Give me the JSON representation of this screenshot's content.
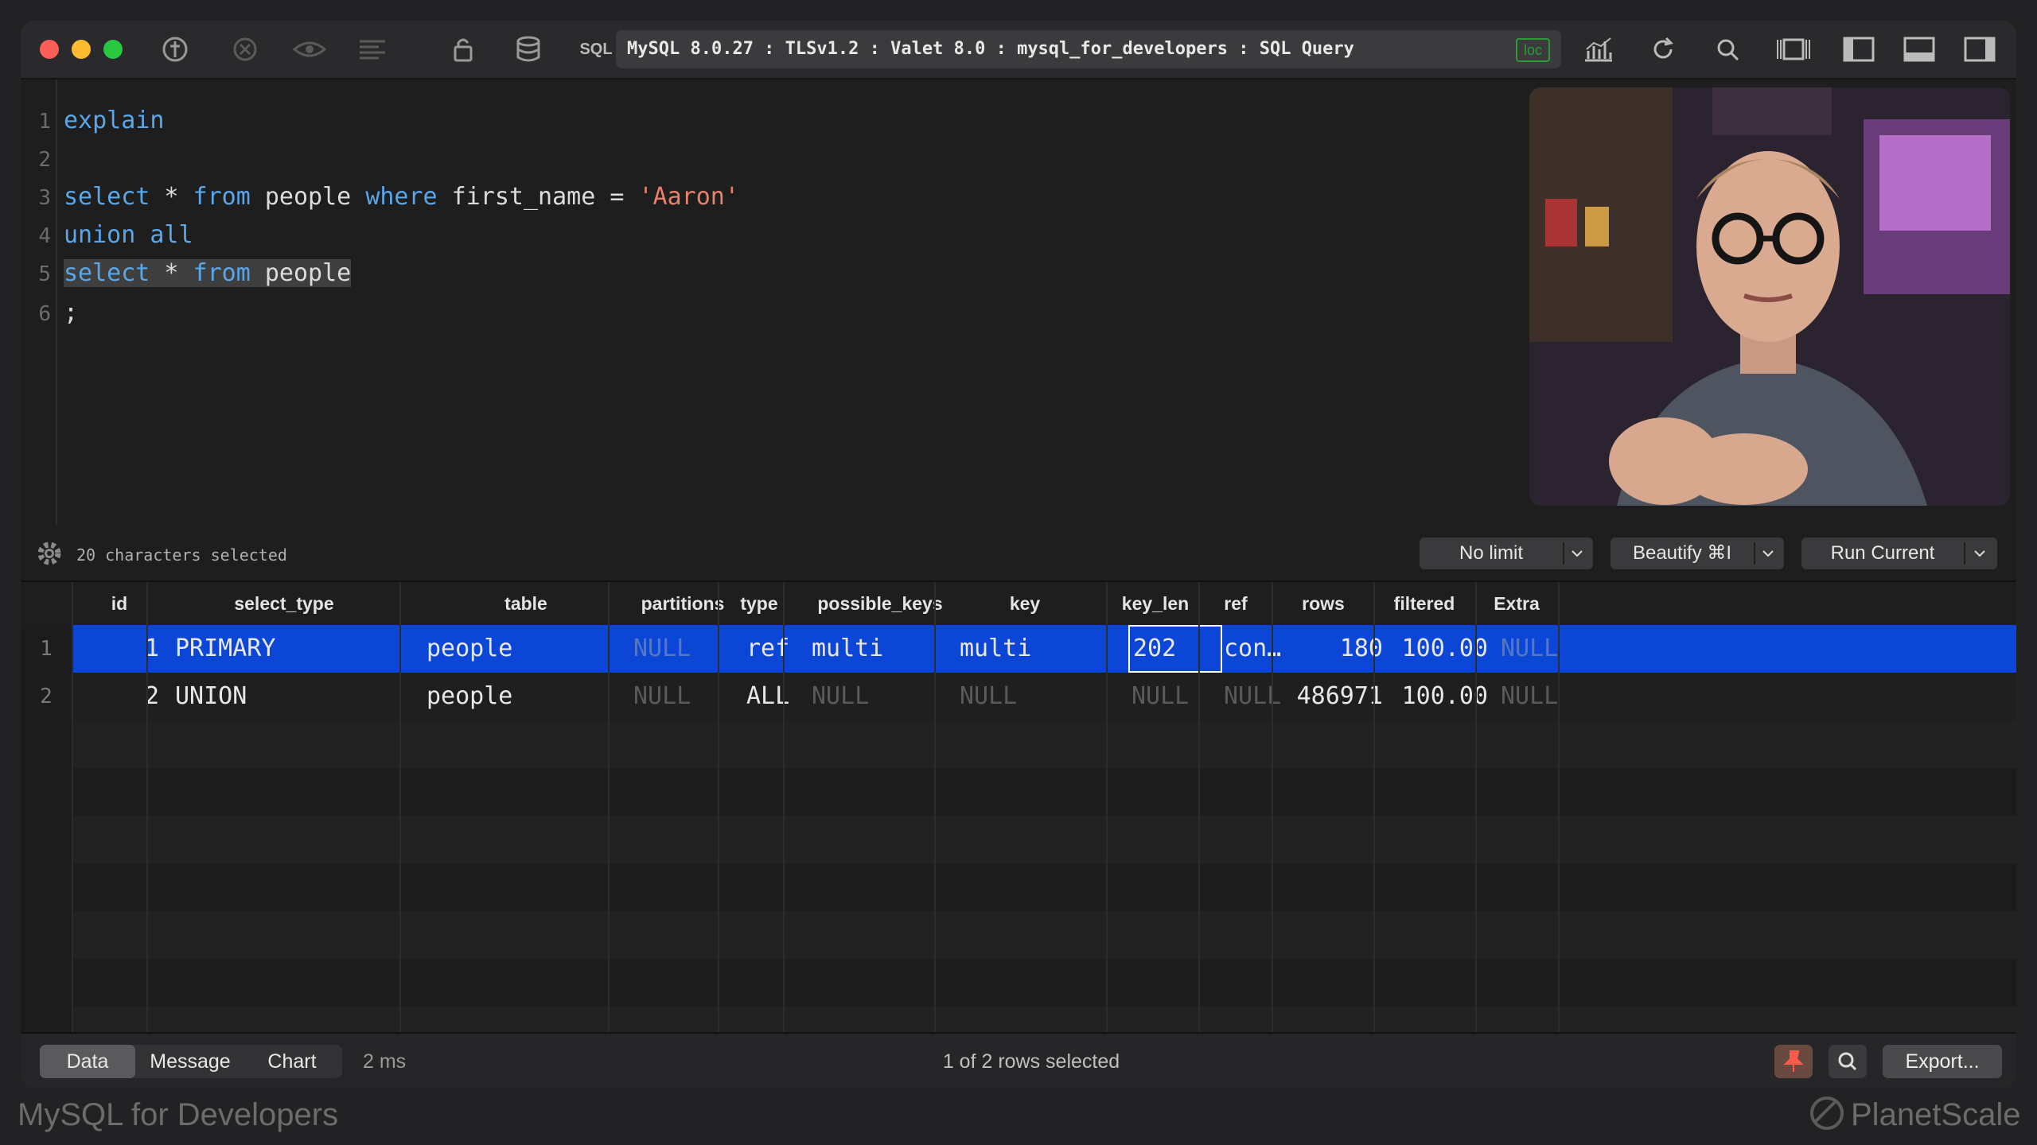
{
  "window": {
    "connection_title": "MySQL 8.0.27 : TLSv1.2 : Valet 8.0 : mysql_for_developers : SQL Query",
    "loc_badge": "loc",
    "sql_label": "SQL"
  },
  "editor": {
    "line_numbers": [
      "1",
      "2",
      "3",
      "4",
      "5",
      "6"
    ],
    "lines": {
      "l1_kw": "explain",
      "l3_kw1": "select",
      "l3_mid": " * ",
      "l3_kw2": "from",
      "l3_tbl": " people ",
      "l3_kw3": "where",
      "l3_rest": " first_name = ",
      "l3_str": "'Aaron'",
      "l4_kw": "union all",
      "l5_kw1": "select",
      "l5_mid": " * ",
      "l5_kw2": "from",
      "l5_tbl": " people",
      "l6": ";"
    }
  },
  "status": {
    "selection_info": "20 characters selected",
    "limit_button": "No limit",
    "beautify_button": "Beautify ⌘I",
    "run_button": "Run Current"
  },
  "results": {
    "columns": [
      "id",
      "select_type",
      "table",
      "partitions",
      "type",
      "possible_keys",
      "key",
      "key_len",
      "ref",
      "rows",
      "filtered",
      "Extra"
    ],
    "row_numbers": [
      "1",
      "2"
    ],
    "rows": [
      {
        "id": "1",
        "select_type": "PRIMARY",
        "table": "people",
        "partitions": "NULL",
        "type": "ref",
        "possible_keys": "multi",
        "key": "multi",
        "key_len": "202",
        "ref": "con…",
        "rows": "180",
        "filtered": "100.00",
        "extra": "NULL"
      },
      {
        "id": "2",
        "select_type": "UNION",
        "table": "people",
        "partitions": "NULL",
        "type": "ALL",
        "possible_keys": "NULL",
        "key": "NULL",
        "key_len": "NULL",
        "ref": "NULL",
        "rows": "486971",
        "filtered": "100.00",
        "extra": "NULL"
      }
    ],
    "selected_row_color": "#0b46d6"
  },
  "bottom": {
    "tabs": [
      "Data",
      "Message",
      "Chart"
    ],
    "active_tab": "Data",
    "time": "2 ms",
    "rows_selected": "1 of 2 rows selected",
    "export_button": "Export..."
  },
  "watermarks": {
    "left": "MySQL for Developers",
    "right": "PlanetScale"
  },
  "icons": [
    "connection-icon",
    "stop-icon",
    "eye-icon",
    "format-icon",
    "lock-icon",
    "database-icon",
    "chart-icon",
    "refresh-icon",
    "search-icon",
    "split-icon",
    "left-panel-icon",
    "bottom-panel-icon",
    "right-panel-icon",
    "gear-icon",
    "pin-icon",
    "chevron-down-icon"
  ]
}
